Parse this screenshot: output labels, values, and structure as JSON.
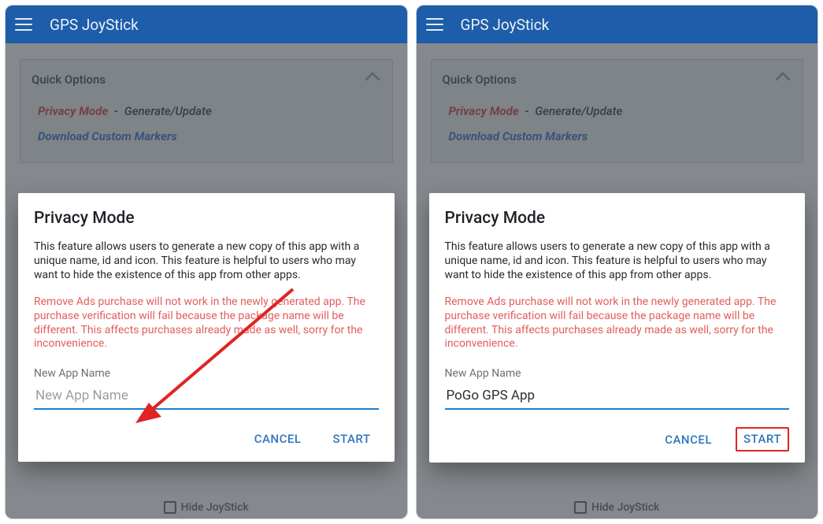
{
  "appbar": {
    "title": "GPS JoyStick"
  },
  "panel": {
    "title": "Quick Options",
    "privacy_mode": "Privacy Mode",
    "generate_update": "Generate/Update",
    "download_markers": "Download Custom Markers"
  },
  "dialog": {
    "title": "Privacy Mode",
    "body": "This feature allows users to generate a new copy of this app with a unique name, id and icon. This feature is helpful to users who may want to hide the existence of this app from other apps.",
    "warning": "Remove Ads purchase will not work in the newly generated app. The purchase verification will fail because the package name will be different. This affects purchases already made as well, sorry for the inconvenience.",
    "field_label": "New App Name",
    "placeholder": "New App Name",
    "cancel": "CANCEL",
    "start": "START"
  },
  "left": {
    "input_value": ""
  },
  "right": {
    "input_value": "PoGo GPS App"
  },
  "hide_joystick": "Hide JoyStick"
}
